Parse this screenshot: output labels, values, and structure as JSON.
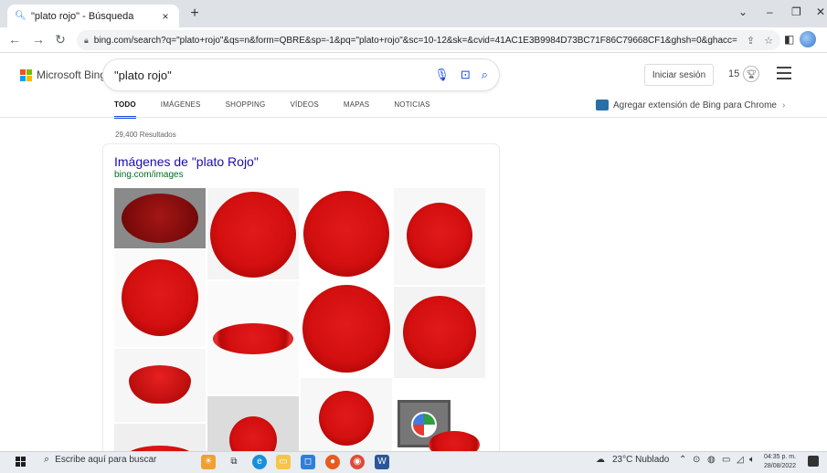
{
  "browser": {
    "tab_title": "\"plato rojo\" - Búsqueda",
    "tab_close": "×",
    "new_tab": "+",
    "url": "bing.com/search?q=\"plato+rojo\"&qs=n&form=QBRE&sp=-1&pq=\"plato+rojo\"&sc=10-12&sk=&cvid=41AC1E3B9984D73BC71F86C79668CF1&ghsh=0&ghacc=0&g...",
    "window_controls": {
      "minimize": "–",
      "maximize": "❐",
      "close": "✕",
      "tabs_menu": "⌄"
    }
  },
  "bing": {
    "logo_text": "Microsoft Bing",
    "logo_colors": [
      "#f25022",
      "#7fba00",
      "#00a4ef",
      "#ffb900"
    ],
    "query": "\"plato rojo\"",
    "sign_in": "Iniciar sesión",
    "rewards_count": "15",
    "scopes": [
      {
        "label": "TODO",
        "active": true
      },
      {
        "label": "IMÁGENES",
        "active": false
      },
      {
        "label": "SHOPPING",
        "active": false
      },
      {
        "label": "VÍDEOS",
        "active": false
      },
      {
        "label": "MAPAS",
        "active": false
      },
      {
        "label": "NOTICIAS",
        "active": false
      }
    ],
    "extension_promo": "Agregar extensión de Bing para Chrome",
    "results_count": "29,400 Resultados",
    "images_card": {
      "title": "Imágenes de \"plato Rojo\"",
      "url": "bing.com/images"
    },
    "accent_color": "#174ae4"
  },
  "taskbar": {
    "search_placeholder": "Escribe aquí para buscar",
    "weather": "23°C Nublado",
    "time": "04:35 p. m.",
    "date": "28/08/2022"
  }
}
